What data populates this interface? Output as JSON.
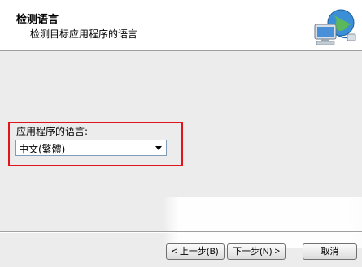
{
  "header": {
    "title": "检测语言",
    "subtitle": "检测目标应用程序的语言"
  },
  "language": {
    "label": "应用程序的语言:",
    "selected": "中文(繁體)"
  },
  "buttons": {
    "back": "< 上一步(B)",
    "next": "下一步(N) >",
    "cancel": "取消"
  },
  "colors": {
    "highlight_border": "#e0141a",
    "header_bg": "#ffffff",
    "body_bg": "#ececec"
  },
  "icons": {
    "header": "network-globe-computer-icon",
    "dropdown": "chevron-down-icon"
  }
}
